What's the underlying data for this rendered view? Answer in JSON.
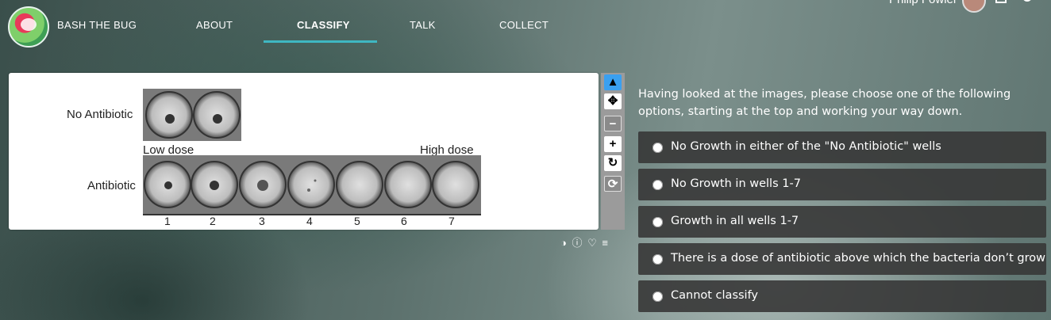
{
  "nav": {
    "brand": "BASH THE BUG",
    "links": [
      "ABOUT",
      "CLASSIFY",
      "TALK",
      "COLLECT"
    ],
    "active": "CLASSIFY",
    "user_name": "Philip Fowler"
  },
  "subject": {
    "row1_label": "No Antibiotic",
    "row2_label": "Antibiotic",
    "low_dose": "Low dose",
    "high_dose": "High dose",
    "well_numbers": [
      "1",
      "2",
      "3",
      "4",
      "5",
      "6",
      "7"
    ]
  },
  "toolbar": {
    "icons": [
      "pointer-icon",
      "pan-icon",
      "zoom-out-icon",
      "zoom-in-icon",
      "rotate-icon",
      "reset-icon"
    ]
  },
  "meta_icons": [
    "contrast-icon",
    "info-icon",
    "favorite-icon",
    "collections-icon"
  ],
  "task": {
    "question": "Having looked at the images, please choose one of the following options, starting at the top and working your way down.",
    "answers": [
      "No Growth in either of the \"No Antibiotic\" wells",
      "No Growth in wells 1-7",
      "Growth in all wells 1-7",
      "There is a dose of antibiotic above which the bacteria don’t grow",
      "Cannot classify"
    ]
  },
  "colors": {
    "accent": "#3fb7c2",
    "tool_selected": "#3aa0f0",
    "answer_bg": "#373737"
  }
}
